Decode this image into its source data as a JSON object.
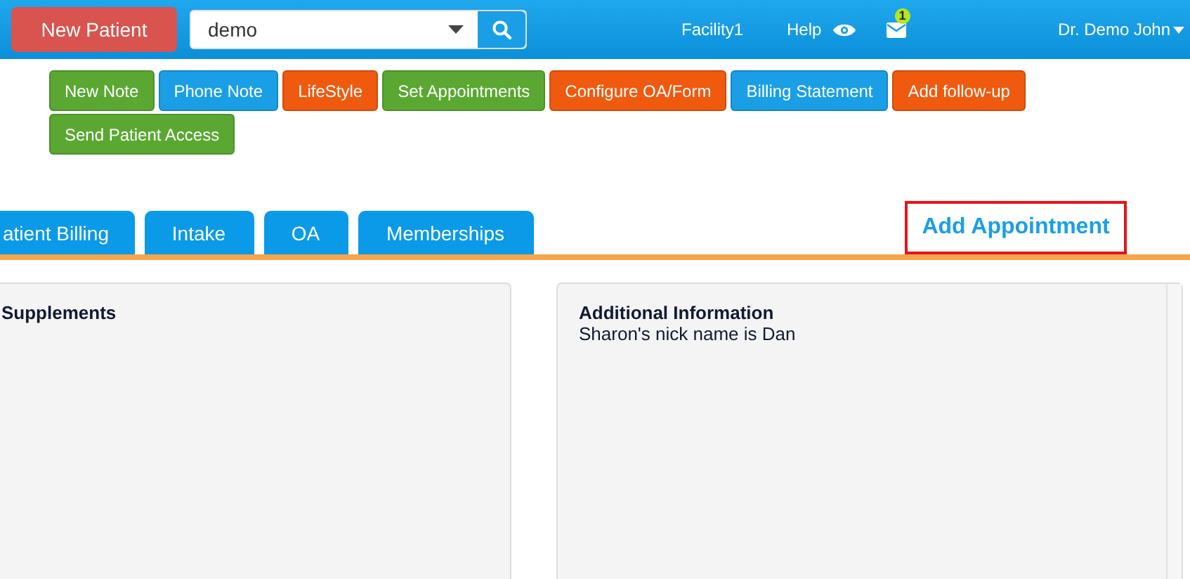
{
  "topbar": {
    "new_patient": "New Patient",
    "search": {
      "value": "demo"
    },
    "facility": "Facility1",
    "help": "Help",
    "mail_badge": "1",
    "user": "Dr. Demo John"
  },
  "actions": [
    {
      "label": "New Note",
      "color": "#5aa832"
    },
    {
      "label": "Phone Note",
      "color": "#1a9fe6"
    },
    {
      "label": "LifeStyle",
      "color": "#f05a0f"
    },
    {
      "label": "Set Appointments",
      "color": "#5aa832"
    },
    {
      "label": "Configure OA/Form",
      "color": "#f05a0f"
    },
    {
      "label": "Billing Statement",
      "color": "#1a9fe6"
    },
    {
      "label": "Add follow-up",
      "color": "#f05a0f"
    },
    {
      "label": "Send Patient Access",
      "color": "#5aa832"
    }
  ],
  "tabs": [
    {
      "label": "atient Billing"
    },
    {
      "label": "Intake"
    },
    {
      "label": "OA"
    },
    {
      "label": "Memberships"
    }
  ],
  "add_appointment": "Add Appointment",
  "panels": [
    {
      "title": "Supplements"
    },
    {
      "title": "Additional Information",
      "text": "Sharon's nick name is Dan"
    }
  ]
}
